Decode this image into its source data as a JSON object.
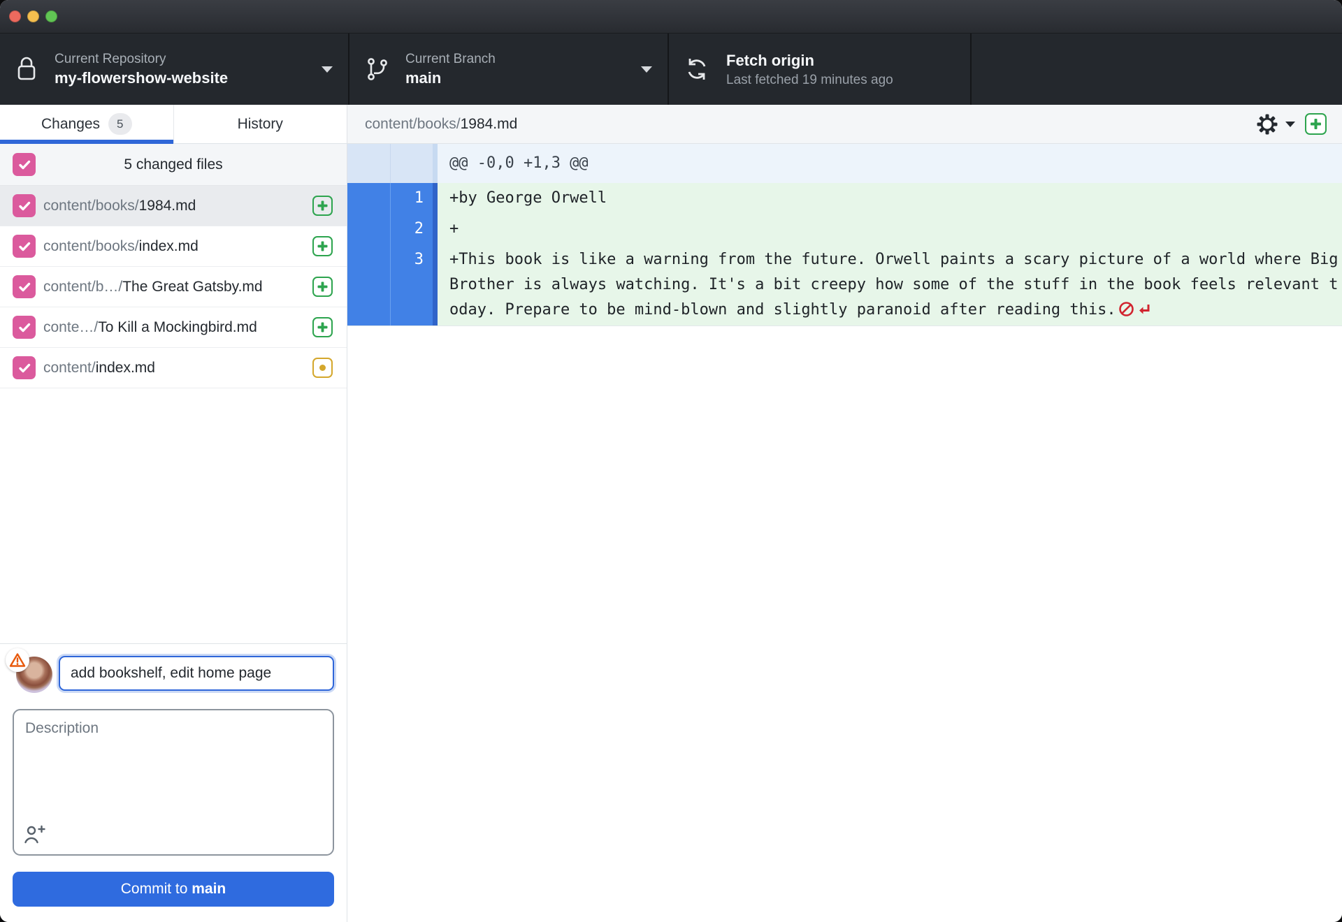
{
  "toolbar": {
    "repository": {
      "label": "Current Repository",
      "value": "my-flowershow-website"
    },
    "branch": {
      "label": "Current Branch",
      "value": "main"
    },
    "fetch": {
      "title": "Fetch origin",
      "subtitle": "Last fetched 19 minutes ago"
    }
  },
  "sidebar": {
    "tabs": [
      {
        "label": "Changes",
        "badge": "5",
        "active": true
      },
      {
        "label": "History",
        "badge": "",
        "active": false
      }
    ],
    "files_header": {
      "label": "5 changed files",
      "checked": true
    },
    "files": [
      {
        "dir": "content/books/",
        "name": "1984.md",
        "status": "added",
        "checked": true,
        "selected": true
      },
      {
        "dir": "content/books/",
        "name": "index.md",
        "status": "added",
        "checked": true,
        "selected": false
      },
      {
        "dir": "content/b…/",
        "name": "The Great Gatsby.md",
        "status": "added",
        "checked": true,
        "selected": false
      },
      {
        "dir": "conte…/",
        "name": "To Kill a Mockingbird.md",
        "status": "added",
        "checked": true,
        "selected": false
      },
      {
        "dir": "content/",
        "name": "index.md",
        "status": "modified",
        "checked": true,
        "selected": false
      }
    ],
    "commit": {
      "summary_value": "add bookshelf, edit home page",
      "description_placeholder": "Description",
      "button_prefix": "Commit to ",
      "button_branch": "main"
    }
  },
  "diff": {
    "file_dir": "content/books/",
    "file_name": "1984.md",
    "hunk_header": "@@ -0,0 +1,3 @@",
    "lines": [
      {
        "new_number": "1",
        "text": "+by George Orwell",
        "no_newline": false
      },
      {
        "new_number": "2",
        "text": "+",
        "no_newline": false
      },
      {
        "new_number": "3",
        "text": "+This book is like a warning from the future. Orwell paints a scary picture of a world where Big Brother is always watching. It's a bit creepy how some of the stuff in the book feels relevant today. Prepare to be mind-blown and slightly paranoid after reading this.",
        "no_newline": true
      }
    ]
  },
  "colors": {
    "checkbox_pink": "#db5a9d",
    "accent_blue": "#2f67d8",
    "commit_button_blue": "#2f6bdf",
    "added_green": "#2da44e",
    "modified_yellow": "#d4a72c",
    "diff_added_bg": "#e7f6e9",
    "diff_gutter_selected": "#4181e6",
    "hunk_bg": "#edf4fb",
    "no_newline_red": "#d1242f",
    "warning_orange": "#e8590c"
  }
}
